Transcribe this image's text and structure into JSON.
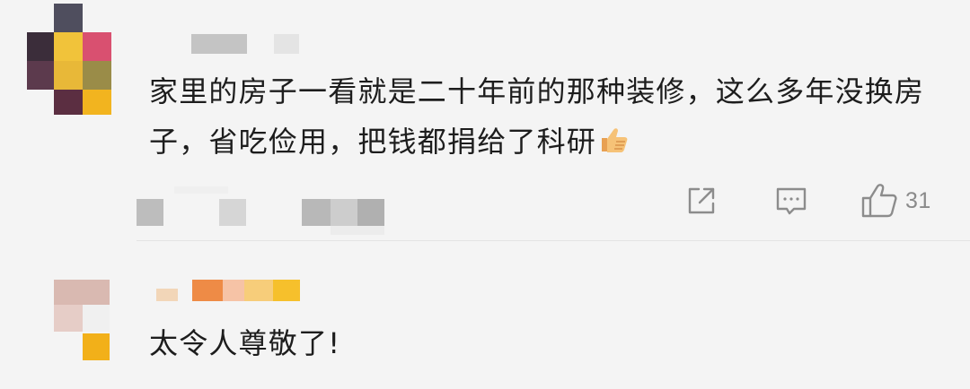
{
  "comments": [
    {
      "text": "家里的房子一看就是二十年前的那种装修，这么多年没换房子，省吃俭用，把钱都捐给了科研",
      "emoji": "thumbs-up-emoji",
      "likes": "31",
      "actions": {
        "share_icon": "share-icon",
        "reply_icon": "comment-icon",
        "like_icon": "thumbs-up-icon"
      }
    },
    {
      "text": "太令人尊敬了!"
    }
  ],
  "colors": {
    "background": "#f4f4f4",
    "text": "#1d1d1d",
    "muted": "#8a8a8a",
    "icon": "#8c8c8c",
    "divider": "#e3e3e3"
  }
}
